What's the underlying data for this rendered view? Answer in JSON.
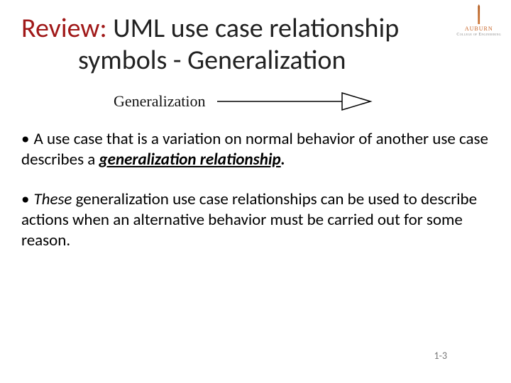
{
  "logo": {
    "name": "AUBURN",
    "sub": "College of Engineering"
  },
  "title": {
    "review_word": "Review:",
    "rest_line1": " UML use case relationship",
    "line2": "symbols - Generalization"
  },
  "diagram": {
    "label": "Generalization"
  },
  "bullets": {
    "b1": {
      "marker": "•",
      "pre": "A use case that is a variation on normal behavior of another use case describes a ",
      "emph": "generalization relationship",
      "post": "."
    },
    "b2": {
      "marker": "•",
      "lead_italic": "These",
      "rest": " generalization use case  relationships can be used to describe actions when an alternative behavior must be carried out for some reason."
    }
  },
  "page_number": "1-3"
}
